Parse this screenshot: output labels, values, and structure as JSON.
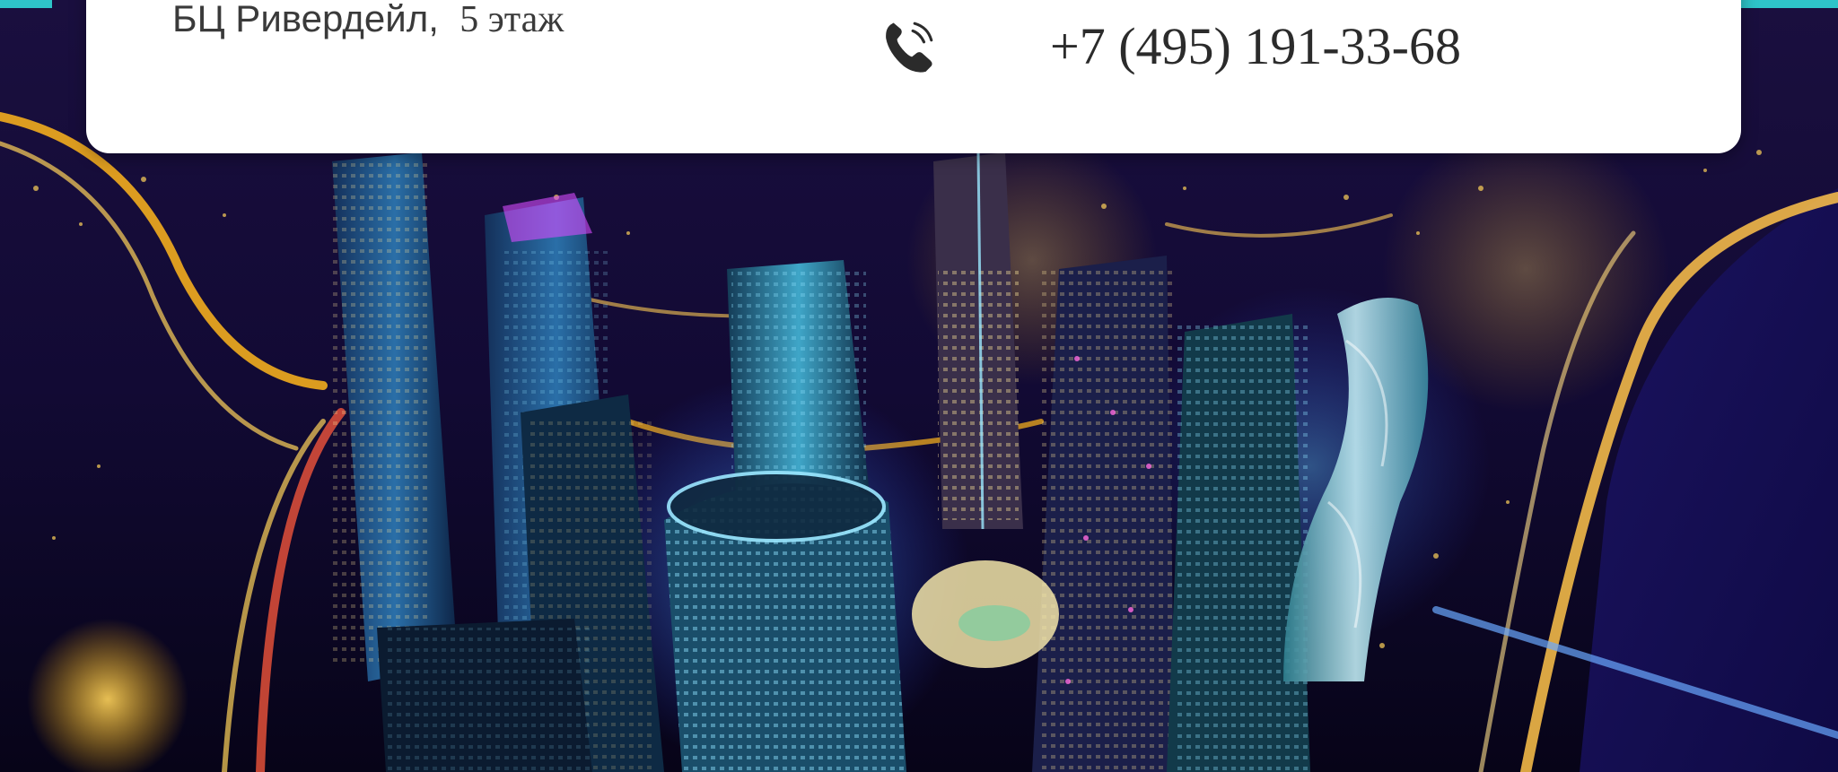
{
  "contact": {
    "address_building": "БЦ Ривердейл,",
    "address_floor": "5 этаж",
    "phone_icon": "phone-icon",
    "phone_number": "+7 (495) 191-33-68"
  },
  "background": {
    "image": "night-city-aerial-photo",
    "colors": {
      "accent": "#2ec4c9",
      "card": "#ffffff",
      "text": "#3a3a3a"
    }
  }
}
